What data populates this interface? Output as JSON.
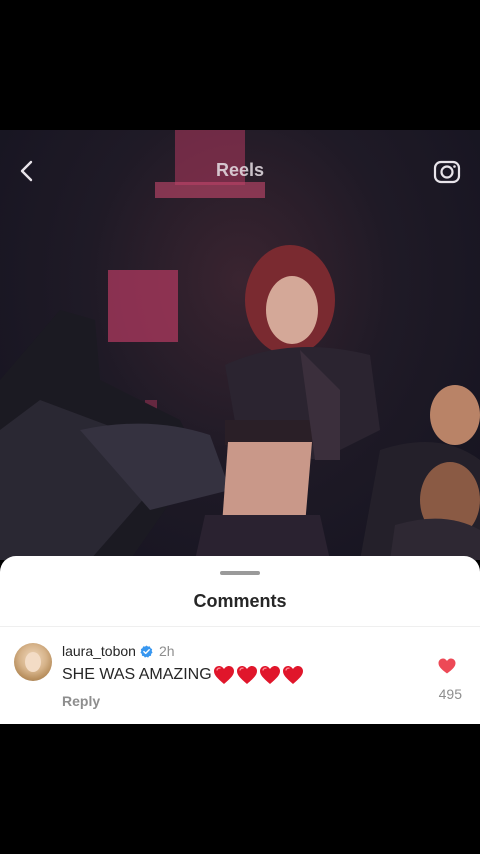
{
  "header": {
    "title": "Reels",
    "back_icon": "chevron-left-icon",
    "camera_icon": "camera-icon"
  },
  "sheet": {
    "title": "Comments"
  },
  "comments": [
    {
      "username": "laura_tobon",
      "verified": true,
      "timestamp": "2h",
      "text": "SHE WAS AMAZING",
      "emoji_count": 4,
      "reply_label": "Reply",
      "like_count": "495",
      "liked": true
    }
  ],
  "colors": {
    "like": "#ed4956",
    "verified": "#3897f0",
    "sheet_bg": "#ffffff",
    "muted_text": "#8e8e8e"
  }
}
